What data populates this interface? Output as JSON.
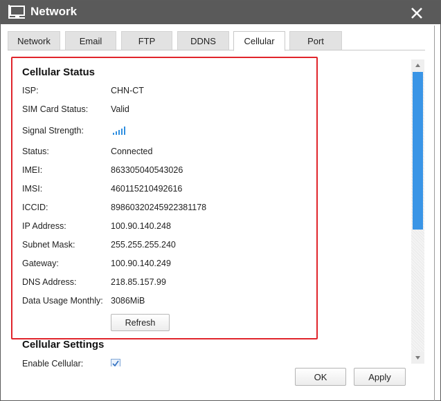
{
  "window": {
    "title": "Network",
    "icon": "network-monitor-icon",
    "close_icon": "close-icon"
  },
  "tabs": [
    {
      "label": "Network",
      "active": false
    },
    {
      "label": "Email",
      "active": false
    },
    {
      "label": "FTP",
      "active": false
    },
    {
      "label": "DDNS",
      "active": false
    },
    {
      "label": "Cellular",
      "active": true
    },
    {
      "label": "Port",
      "active": false
    }
  ],
  "cellular_status": {
    "title": "Cellular Status",
    "fields": [
      {
        "label": "ISP:",
        "value": "CHN-CT"
      },
      {
        "label": "SIM Card Status:",
        "value": "Valid"
      },
      {
        "label": "Signal Strength:",
        "value": ""
      },
      {
        "label": "Status:",
        "value": "Connected"
      },
      {
        "label": "IMEI:",
        "value": "863305040543026"
      },
      {
        "label": "IMSI:",
        "value": "460115210492616"
      },
      {
        "label": "ICCID:",
        "value": "89860320245922381178"
      },
      {
        "label": "IP Address:",
        "value": "100.90.140.248"
      },
      {
        "label": "Subnet Mask:",
        "value": "255.255.255.240"
      },
      {
        "label": "Gateway:",
        "value": "100.90.140.249"
      },
      {
        "label": "DNS Address:",
        "value": "218.85.157.99"
      },
      {
        "label": "Data Usage Monthly:",
        "value": "3086MiB"
      }
    ],
    "signal_icon": "signal-bars-icon",
    "signal_level_bars": 5,
    "refresh_label": "Refresh"
  },
  "cellular_settings": {
    "title": "Cellular Settings",
    "enable_label": "Enable Cellular:",
    "enable_checked": true
  },
  "footer": {
    "ok_label": "OK",
    "apply_label": "Apply"
  },
  "colors": {
    "titlebar": "#5a5a5a",
    "highlight_border": "#e0242b",
    "scroll_thumb": "#3a95e6",
    "signal": "#2f8fe0"
  }
}
